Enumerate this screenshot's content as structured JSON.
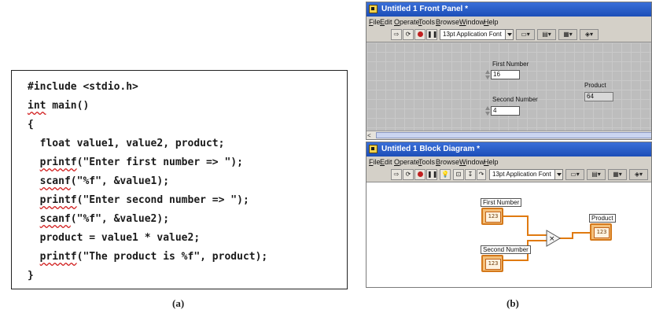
{
  "figure_a": {
    "code_lines": [
      {
        "pre": "",
        "ul": "",
        "rest": "#include <stdio.h>"
      },
      {
        "pre": "",
        "ul": "int",
        "rest": " main()"
      },
      {
        "pre": "",
        "ul": "",
        "rest": "{"
      },
      {
        "pre": "  ",
        "ul": "",
        "rest": "float value1, value2, product;"
      },
      {
        "pre": "  ",
        "ul": "printf",
        "rest": "(\"Enter first number => \");"
      },
      {
        "pre": "  ",
        "ul": "scanf",
        "rest": "(\"%f\", &value1);"
      },
      {
        "pre": "  ",
        "ul": "printf",
        "rest": "(\"Enter second number => \");"
      },
      {
        "pre": "  ",
        "ul": "scanf",
        "rest": "(\"%f\", &value2);"
      },
      {
        "pre": "  ",
        "ul": "",
        "rest": "product = value1 * value2;"
      },
      {
        "pre": "  ",
        "ul": "printf",
        "rest": "(\"The product is %f\", product);"
      },
      {
        "pre": "",
        "ul": "",
        "rest": "}"
      }
    ],
    "caption": "(a)"
  },
  "figure_b": {
    "caption": "(b)",
    "front_panel": {
      "title": "Untitled 1 Front Panel *",
      "menu": [
        "File",
        "Edit",
        "Operate",
        "Tools",
        "Browse",
        "Window",
        "Help"
      ],
      "font_select": "13pt Application Font",
      "first_number_label": "First Number",
      "first_number_value": "16",
      "second_number_label": "Second Number",
      "second_number_value": "4",
      "product_label": "Product",
      "product_value": "64",
      "scroll_left_arrow": "<"
    },
    "block_diagram": {
      "title": "Untitled 1 Block Diagram *",
      "menu": [
        "File",
        "Edit",
        "Operate",
        "Tools",
        "Browse",
        "Window",
        "Help"
      ],
      "font_select": "13pt Application Font",
      "first_number_label": "First Number",
      "second_number_label": "Second Number",
      "product_label": "Product",
      "terminal_type": "123"
    }
  },
  "colors": {
    "title_bar": "#2a5ed0",
    "wire": "#e07a10",
    "terminal_border": "#d4781a",
    "canvas_grid": "#bdbdbd"
  }
}
